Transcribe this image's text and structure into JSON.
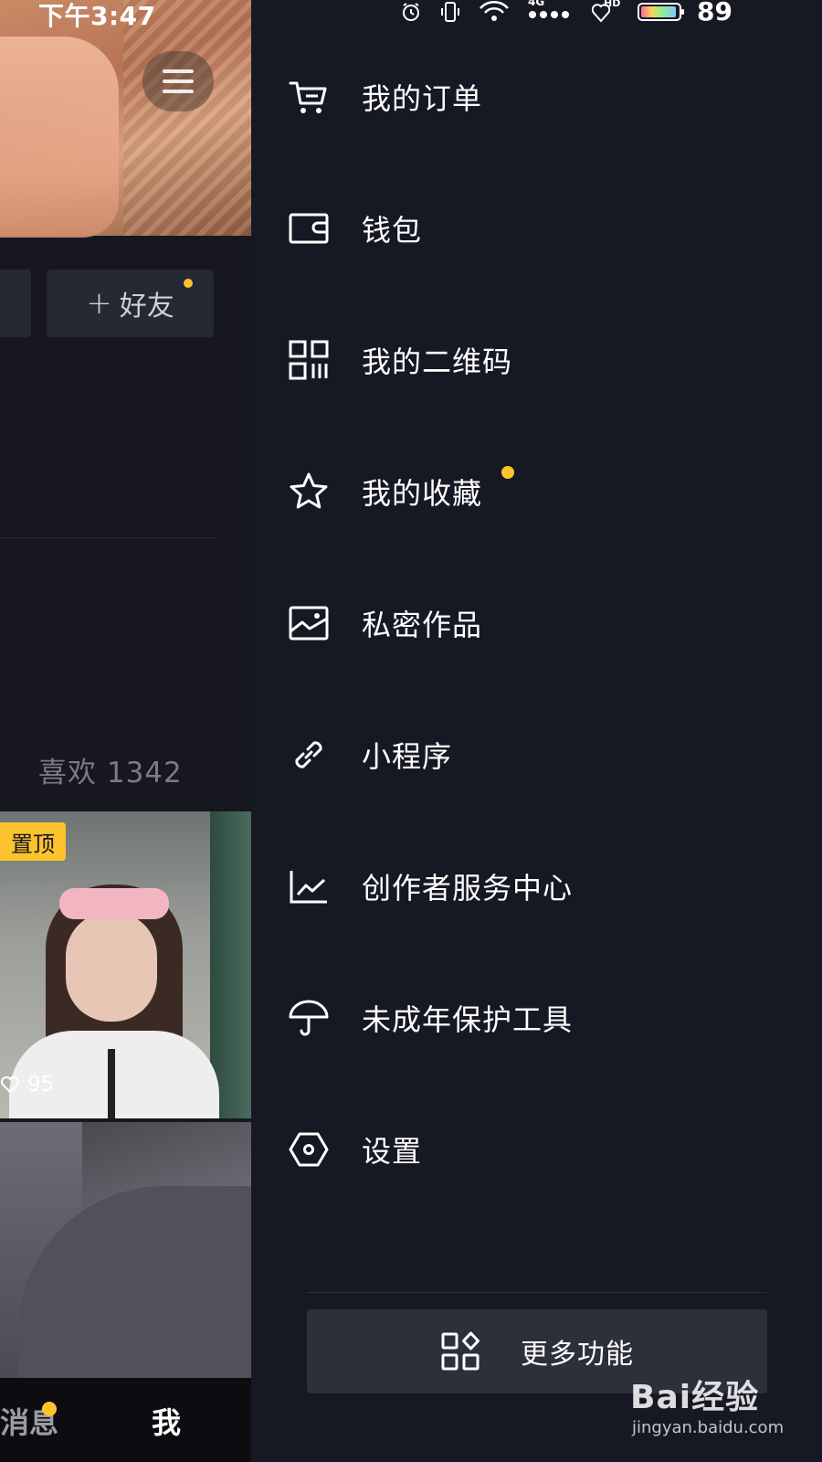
{
  "status_bar": {
    "time": "下午3:47",
    "battery": "89",
    "network": "4G",
    "hd": "HD",
    "icons": [
      "alarm-icon",
      "vibrate-icon",
      "wifi-icon",
      "signal-icon",
      "hd-call-icon",
      "battery-icon"
    ]
  },
  "profile": {
    "add_friend_label": "好友",
    "add_friend_prefix": "+",
    "likes_tab": "喜欢 1342",
    "pinned_badge": "置顶",
    "video1_plays": "95",
    "nav": {
      "messages": "消息",
      "me": "我"
    }
  },
  "drawer": {
    "items": [
      {
        "label": "我的订单",
        "icon": "shopping-cart-icon"
      },
      {
        "label": "钱包",
        "icon": "wallet-icon"
      },
      {
        "label": "我的二维码",
        "icon": "qr-code-icon"
      },
      {
        "label": "我的收藏",
        "icon": "star-icon",
        "badge": true
      },
      {
        "label": "私密作品",
        "icon": "image-icon"
      },
      {
        "label": "小程序",
        "icon": "link-icon"
      },
      {
        "label": "创作者服务中心",
        "icon": "chart-icon"
      },
      {
        "label": "未成年保护工具",
        "icon": "umbrella-icon"
      },
      {
        "label": "设置",
        "icon": "hexagon-settings-icon"
      }
    ],
    "more_button": "更多功能"
  },
  "watermark": {
    "logo": "Bai经验",
    "sub": "jingyan.baidu.com"
  },
  "colors": {
    "drawer_bg": "#161823",
    "accent_dot": "#fcc32d",
    "button_bg": "#2d2f3a",
    "text": "#ffffff",
    "muted_text": "#7a7b84"
  }
}
